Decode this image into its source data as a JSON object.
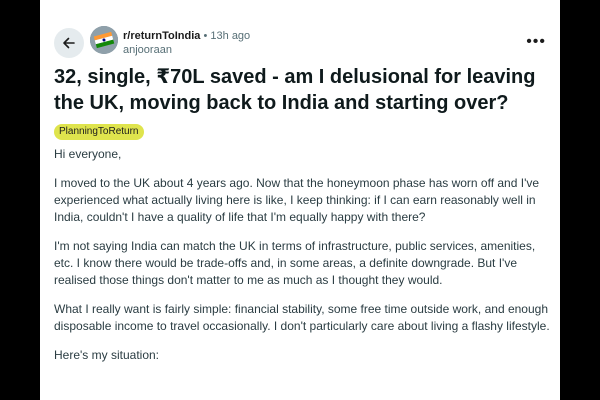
{
  "post": {
    "subreddit": "r/returnToIndia",
    "separator": "•",
    "time_ago": "13h ago",
    "author": "anjooraan",
    "more_label": "•••",
    "title": "32, single, ₹70L saved - am I delusional for leaving the UK, moving back to India and starting over?",
    "flair": "PlanningToReturn",
    "body": [
      "Hi everyone,",
      "I moved to the UK about 4 years ago. Now that the honeymoon phase has worn off and I've experienced what actually living here is like, I keep thinking: if I can earn reasonably well in India, couldn't I have a quality of life that I'm equally happy with there?",
      "I'm not saying India can match the UK in terms of infrastructure, public services, amenities, etc. I know there would be trade-offs and, in some areas, a definite downgrade. But I've realised those things don't matter to me as much as I thought they would.",
      "What I really want is fairly simple: financial stability, some free time outside work, and enough disposable income to travel occasionally. I don't particularly care about living a flashy lifestyle.",
      "Here's my situation:"
    ]
  },
  "colors": {
    "background": "#000000",
    "card": "#ffffff",
    "flair_bg": "#dfe44d",
    "meta_text": "#576f76"
  },
  "icons": {
    "back": "arrow-left-icon",
    "avatar": "subreddit-avatar-flag",
    "more": "more-options-icon"
  }
}
